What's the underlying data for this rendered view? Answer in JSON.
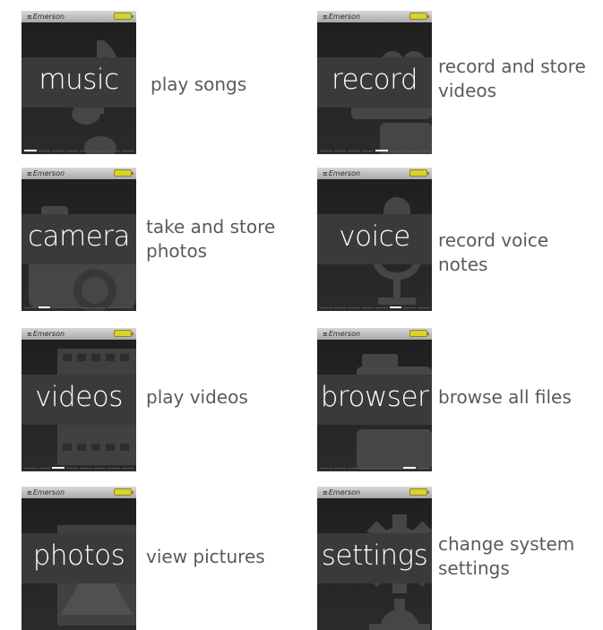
{
  "brand": "Emerson",
  "brand_mark": "≡",
  "colors": {
    "screen_bg": "#232323",
    "band": "#3a3a3a",
    "battery": "#d9d32a",
    "caption": "#5a5a5a"
  },
  "screens": [
    {
      "label": "music",
      "caption_lines": [
        "play songs"
      ],
      "icon": "music-note-icon",
      "active_dot": 0
    },
    {
      "label": "record",
      "caption_lines": [
        "record and store",
        "videos"
      ],
      "icon": "camcorder-icon",
      "active_dot": 4
    },
    {
      "label": "camera",
      "caption_lines": [
        "take and store",
        "photos"
      ],
      "icon": "camera-icon",
      "active_dot": 1
    },
    {
      "label": "voice",
      "caption_lines": [
        "record voice notes"
      ],
      "icon": "microphone-icon",
      "active_dot": 5
    },
    {
      "label": "videos",
      "caption_lines": [
        "play videos"
      ],
      "icon": "film-strip-icon",
      "active_dot": 2
    },
    {
      "label": "browser",
      "caption_lines": [
        "browse all files"
      ],
      "icon": "folder-icon",
      "active_dot": 6
    },
    {
      "label": "photos",
      "caption_lines": [
        "view pictures"
      ],
      "icon": "picture-icon",
      "active_dot": 3
    },
    {
      "label": "settings",
      "caption_lines": [
        "change system",
        "settings"
      ],
      "icon": "gear-icon",
      "active_dot": 7
    }
  ]
}
